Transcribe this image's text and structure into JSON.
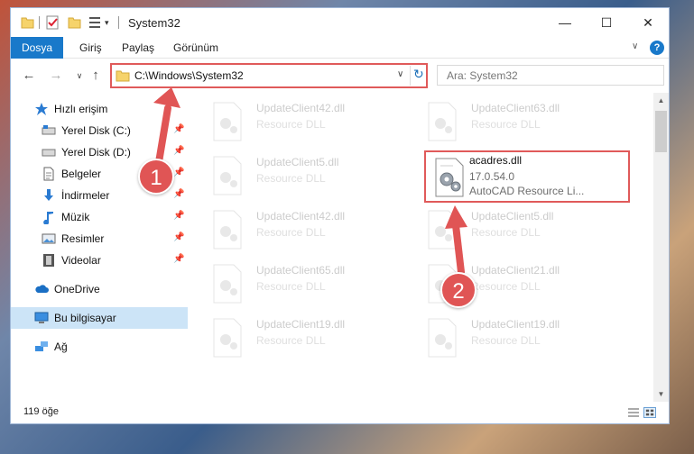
{
  "window": {
    "title": "System32",
    "controls": {
      "minimize": "—",
      "maximize": "☐",
      "close": "✕"
    }
  },
  "quick_access": {
    "caret": "▾"
  },
  "ribbon": {
    "tabs": [
      {
        "label": "Dosya",
        "active": true
      },
      {
        "label": "Giriş"
      },
      {
        "label": "Paylaş"
      },
      {
        "label": "Görünüm"
      }
    ],
    "expand_glyph": "∨",
    "help_glyph": "?"
  },
  "nav": {
    "back": "←",
    "forward": "→",
    "recent": "∨",
    "up": "↑",
    "address": "C:\\Windows\\System32",
    "address_dropdown": "∨",
    "refresh": "↻",
    "search_placeholder": "Ara: System32"
  },
  "sidebar": {
    "pin_glyph": "📌",
    "items": [
      {
        "label": "Hızlı erişim",
        "icon": "star-icon",
        "pinned": false
      },
      {
        "label": "Yerel Disk (C:)",
        "icon": "drive-icon",
        "pinned": true
      },
      {
        "label": "Yerel Disk (D:)",
        "icon": "drive-icon",
        "pinned": true
      },
      {
        "label": "Belgeler",
        "icon": "document-icon",
        "pinned": true
      },
      {
        "label": "İndirmeler",
        "icon": "download-icon",
        "pinned": true
      },
      {
        "label": "Müzik",
        "icon": "music-icon",
        "pinned": true
      },
      {
        "label": "Resimler",
        "icon": "pictures-icon",
        "pinned": true
      },
      {
        "label": "Videolar",
        "icon": "video-icon",
        "pinned": true
      },
      {
        "label": "OneDrive",
        "icon": "cloud-icon",
        "pinned": false
      },
      {
        "label": "Bu bilgisayar",
        "icon": "computer-icon",
        "selected": true
      },
      {
        "label": "Ağ",
        "icon": "network-icon",
        "pinned": false
      }
    ]
  },
  "files": [
    {
      "name": "UpdateClient42.dll",
      "desc": "Resource DLL",
      "faded": true
    },
    {
      "name": "UpdateClient63.dll",
      "desc": "Resource DLL",
      "faded": true
    },
    {
      "name": "UpdateClient5.dll",
      "desc": "Resource DLL",
      "faded": true
    },
    {
      "name": "acadres.dll",
      "desc": "17.0.54.0",
      "desc2": "AutoCAD Resource Li...",
      "highlighted": true
    },
    {
      "name": "UpdateClient42.dll",
      "desc": "Resource DLL",
      "faded": true
    },
    {
      "name": "UpdateClient5.dll",
      "desc": "Resource DLL",
      "faded": true
    },
    {
      "name": "UpdateClient65.dll",
      "desc": "Resource DLL",
      "faded": true
    },
    {
      "name": "UpdateClient21.dll",
      "desc": "Resource DLL",
      "faded": true
    },
    {
      "name": "UpdateClient19.dll",
      "desc": "Resource DLL",
      "faded": true
    },
    {
      "name": "UpdateClient19.dll",
      "desc": "Resource DLL",
      "faded": true
    }
  ],
  "scrollbar": {
    "up": "▲",
    "down": "▼"
  },
  "status": {
    "count": "119 öğe"
  },
  "annotations": {
    "step1": "1",
    "step2": "2"
  },
  "colors": {
    "accent": "#1979ca",
    "annotation": "#e05a5a",
    "selected": "#cce4f7"
  }
}
